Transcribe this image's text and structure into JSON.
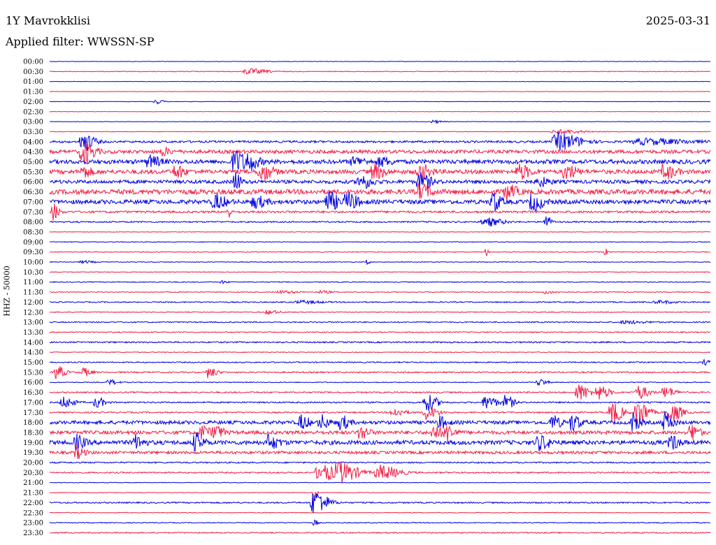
{
  "header": {
    "station": "1Y Mavrokklisi",
    "date": "2025-03-31",
    "filter": "Applied filter: WWSSN-SP"
  },
  "chart_data": {
    "type": "line",
    "title": "1Y Mavrokklisi",
    "ylabel": "HHZ - 50000",
    "colors": [
      "#0000e0",
      "#f01e46"
    ],
    "tick_labels": [
      "00:00",
      "00:30",
      "01:00",
      "01:30",
      "02:00",
      "02:30",
      "03:00",
      "03:30",
      "04:00",
      "04:30",
      "05:00",
      "05:30",
      "06:00",
      "06:30",
      "07:00",
      "07:30",
      "08:00",
      "08:30",
      "09:00",
      "09:30",
      "10:00",
      "10:30",
      "11:00",
      "11:30",
      "12:00",
      "12:30",
      "13:00",
      "13:30",
      "14:00",
      "14:30",
      "15:00",
      "15:30",
      "16:00",
      "16:30",
      "17:00",
      "17:30",
      "18:00",
      "18:30",
      "19:00",
      "19:30",
      "20:00",
      "20:30",
      "21:00",
      "21:30",
      "22:00",
      "22:30",
      "23:00",
      "23:30"
    ],
    "noise_level": [
      0.3,
      0.5,
      0.3,
      0.3,
      0.3,
      0.3,
      0.3,
      0.4,
      1.5,
      2.5,
      3,
      3,
      2.5,
      3.5,
      3,
      1.5,
      1,
      0.4,
      0.5,
      0.6,
      0.5,
      0.5,
      0.6,
      0.6,
      0.8,
      0.6,
      0.8,
      0.8,
      1,
      0.6,
      0.8,
      1,
      0.6,
      1,
      1,
      1,
      2.5,
      2.5,
      3,
      2,
      1,
      1,
      0.4,
      0.4,
      1,
      0.5,
      0.6,
      0.8
    ],
    "events": [
      [],
      [
        [
          0.3,
          4,
          0.035
        ]
      ],
      [],
      [],
      [
        [
          0.16,
          3,
          0.015
        ]
      ],
      [],
      [
        [
          0.58,
          2,
          0.02
        ]
      ],
      [
        [
          0.77,
          3,
          0.05
        ]
      ],
      [
        [
          0.77,
          12,
          0.04
        ],
        [
          0.05,
          14,
          0.02
        ],
        [
          0.9,
          4,
          0.08
        ]
      ],
      [
        [
          0.05,
          16,
          0.02
        ],
        [
          0.17,
          5,
          0.015
        ]
      ],
      [
        [
          0.15,
          8,
          0.02
        ],
        [
          0.28,
          16,
          0.02
        ],
        [
          0.3,
          10,
          0.02
        ],
        [
          0.46,
          6,
          0.02
        ],
        [
          0.5,
          6,
          0.02
        ]
      ],
      [
        [
          0.05,
          8,
          0.015
        ],
        [
          0.19,
          10,
          0.015
        ],
        [
          0.32,
          12,
          0.02
        ],
        [
          0.49,
          10,
          0.02
        ],
        [
          0.56,
          10,
          0.02
        ],
        [
          0.71,
          10,
          0.02
        ],
        [
          0.78,
          10,
          0.02
        ],
        [
          0.93,
          10,
          0.02
        ]
      ],
      [
        [
          0.28,
          16,
          0.01
        ],
        [
          0.47,
          10,
          0.02
        ],
        [
          0.56,
          12,
          0.02
        ],
        [
          0.74,
          6,
          0.02
        ]
      ],
      [
        [
          0.56,
          10,
          0.02
        ],
        [
          0.69,
          10,
          0.02
        ]
      ],
      [
        [
          0.25,
          10,
          0.02
        ],
        [
          0.31,
          8,
          0.02
        ],
        [
          0.42,
          14,
          0.02
        ],
        [
          0.45,
          12,
          0.02
        ],
        [
          0.67,
          14,
          0.015
        ],
        [
          0.73,
          12,
          0.02
        ]
      ],
      [
        [
          0.005,
          12,
          0.01
        ],
        [
          0.27,
          10,
          0.005
        ]
      ],
      [
        [
          0.66,
          6,
          0.03
        ],
        [
          0.75,
          10,
          0.01
        ]
      ],
      [],
      [],
      [
        [
          0.66,
          6,
          0.005
        ],
        [
          0.84,
          6,
          0.005
        ]
      ],
      [
        [
          0.05,
          2,
          0.02
        ],
        [
          0.48,
          4,
          0.005
        ]
      ],
      [],
      [
        [
          0.26,
          2,
          0.01
        ]
      ],
      [
        [
          0.35,
          2,
          0.03
        ],
        [
          0.41,
          2,
          0.02
        ],
        [
          0.75,
          2,
          0.02
        ]
      ],
      [
        [
          0.38,
          2,
          0.04
        ],
        [
          0.92,
          2,
          0.03
        ]
      ],
      [
        [
          0.33,
          3,
          0.02
        ]
      ],
      [
        [
          0.87,
          2,
          0.04
        ]
      ],
      [],
      [],
      [],
      [
        [
          0.99,
          4,
          0.01
        ]
      ],
      [
        [
          0.01,
          10,
          0.015
        ],
        [
          0.05,
          6,
          0.015
        ],
        [
          0.24,
          8,
          0.015
        ]
      ],
      [
        [
          0.09,
          4,
          0.015
        ],
        [
          0.74,
          5,
          0.015
        ]
      ],
      [
        [
          0.8,
          12,
          0.02
        ],
        [
          0.83,
          10,
          0.02
        ],
        [
          0.89,
          10,
          0.02
        ],
        [
          0.93,
          8,
          0.02
        ]
      ],
      [
        [
          0.02,
          8,
          0.02
        ],
        [
          0.07,
          8,
          0.015
        ],
        [
          0.57,
          12,
          0.02
        ],
        [
          0.66,
          10,
          0.02
        ],
        [
          0.69,
          10,
          0.015
        ]
      ],
      [
        [
          0.52,
          6,
          0.02
        ],
        [
          0.57,
          10,
          0.02
        ],
        [
          0.85,
          16,
          0.02
        ],
        [
          0.89,
          18,
          0.02
        ],
        [
          0.94,
          14,
          0.02
        ]
      ],
      [
        [
          0.38,
          10,
          0.015
        ],
        [
          0.41,
          10,
          0.015
        ],
        [
          0.44,
          10,
          0.015
        ],
        [
          0.59,
          8,
          0.015
        ],
        [
          0.76,
          10,
          0.015
        ],
        [
          0.79,
          12,
          0.015
        ],
        [
          0.88,
          14,
          0.015
        ],
        [
          0.93,
          14,
          0.015
        ]
      ],
      [
        [
          0.23,
          10,
          0.015
        ],
        [
          0.25,
          10,
          0.015
        ],
        [
          0.47,
          10,
          0.015
        ],
        [
          0.58,
          10,
          0.015
        ],
        [
          0.6,
          12,
          0.015
        ],
        [
          0.97,
          12,
          0.015
        ]
      ],
      [
        [
          0.04,
          10,
          0.015
        ],
        [
          0.13,
          10,
          0.015
        ],
        [
          0.22,
          12,
          0.015
        ],
        [
          0.33,
          10,
          0.02
        ],
        [
          0.74,
          10,
          0.02
        ],
        [
          0.94,
          10,
          0.015
        ]
      ],
      [
        [
          0.04,
          8,
          0.015
        ]
      ],
      [],
      [
        [
          0.41,
          12,
          0.035
        ],
        [
          0.44,
          12,
          0.035
        ],
        [
          0.5,
          10,
          0.035
        ]
      ],
      [],
      [
        [
          0.4,
          8,
          0.006
        ]
      ],
      [
        [
          0.4,
          18,
          0.025
        ]
      ],
      [],
      [
        [
          0.4,
          6,
          0.006
        ]
      ],
      []
    ]
  }
}
